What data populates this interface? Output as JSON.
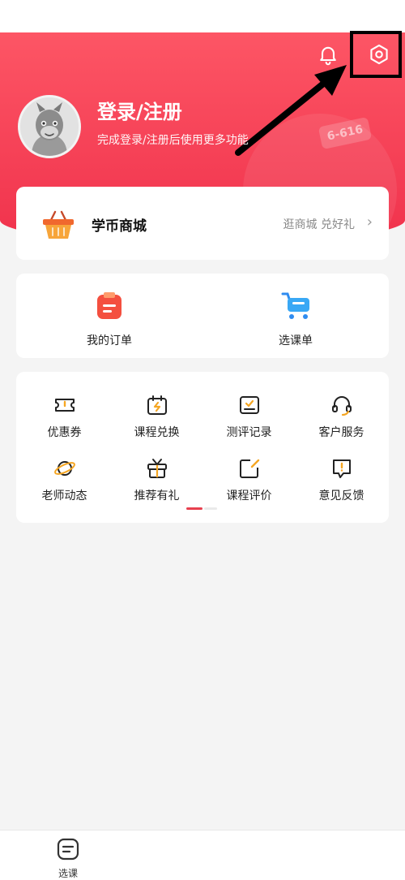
{
  "header": {
    "login_title": "登录/注册",
    "login_subtitle": "完成登录/注册后使用更多功能",
    "decor_sign": "6-616",
    "icons": {
      "bell": "bell-icon",
      "settings": "settings-gear-icon"
    }
  },
  "mall": {
    "title": "学币商城",
    "link": "逛商城 兑好礼",
    "chevron": "›"
  },
  "orders": [
    {
      "label": "我的订单",
      "icon": "clipboard-icon"
    },
    {
      "label": "选课单",
      "icon": "cart-icon"
    }
  ],
  "services": [
    {
      "label": "优惠券",
      "icon": "coupon-icon"
    },
    {
      "label": "课程兑换",
      "icon": "calendar-exchange-icon"
    },
    {
      "label": "测评记录",
      "icon": "assessment-record-icon"
    },
    {
      "label": "客户服务",
      "icon": "headset-icon"
    },
    {
      "label": "老师动态",
      "icon": "planet-icon"
    },
    {
      "label": "推荐有礼",
      "icon": "gift-icon"
    },
    {
      "label": "课程评价",
      "icon": "edit-review-icon"
    },
    {
      "label": "意见反馈",
      "icon": "feedback-icon"
    }
  ],
  "tabbar": {
    "items": [
      {
        "label": "选课",
        "icon": "course-icon"
      }
    ]
  },
  "colors": {
    "brand_red": "#f0324c",
    "accent_orange": "#f5a623"
  }
}
